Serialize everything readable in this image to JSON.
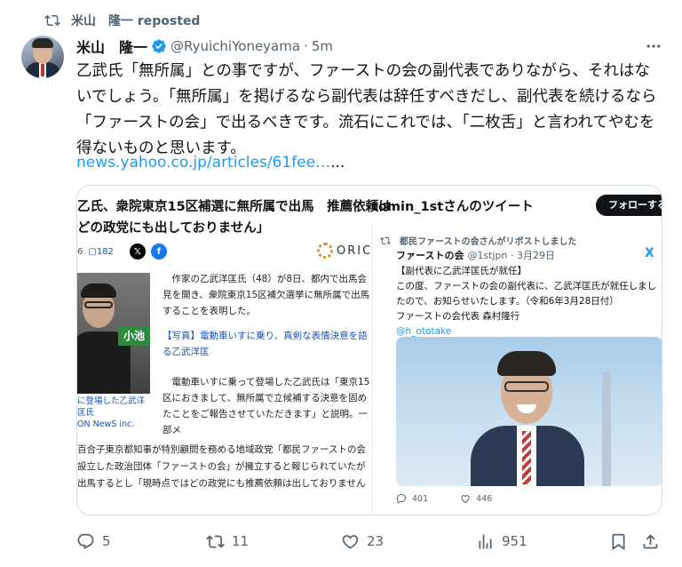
{
  "repost": {
    "label": "米山　隆一 reposted"
  },
  "author": {
    "name": "米山　隆一",
    "handle": "@RyuichiYoneyama",
    "separator": "·",
    "time": "5m"
  },
  "tweet": {
    "text": "乙武氏「無所属」との事ですが、ファーストの会の副代表でありながら、それはないでしょう。「無所属」を掲げるなら副代表は辞任すべきだし、副代表を続けるなら「ファーストの会」で出るべきです。流石にこれでは、「二枚舌」と言われてやむを得ないものと思います。",
    "link": "news.yahoo.co.jp/articles/61fee…",
    "link_suffix": "..."
  },
  "card": {
    "article": {
      "headline_line1": "乙氏、衆院東京15区補選に無所属で出馬　推薦依頼は",
      "headline_line2": "どの政党にも出しておりません」",
      "meta_count": "6",
      "comments": "182",
      "source": "ORICO",
      "photo_sign": "小池",
      "photo_caption": "に登場した乙武洋匡氏\nON NewS inc.",
      "body_p1": "作家の乙武洋匡氏（48）が8日、都内で出馬会見を開き、衆院東京15区補欠選挙に無所属で出馬することを表明した。",
      "body_link": "【写真】電動車いすに乗り、真剣な表情決意を語る乙武洋匡",
      "body_p2": "電動車いすに乗って登場した乙武氏は「東京15区におきまして、無所属で立候補する決意を固めたことをご報告させていただきます」と説明。一部メ",
      "bottom_lines": [
        "百合子東京都知事が特別顧問を務める地域政党「都民ファーストの会",
        "設立した政治団体「ファーストの会」が擁立すると報じられていたが",
        "出馬するとし「現時点ではどの政党にも推薦依頼は出しておりません"
      ]
    },
    "embed": {
      "title": "tomin_1stさんのツイート",
      "follow_label": "フォローする",
      "reposted_by": "都民ファーストの会さんがリポストしました",
      "account_name": "ファーストの会",
      "account_handle": "@1stjpn · 3月29日",
      "x_logo": "X",
      "body_line1": "【副代表に乙武洋匡氏が就任】",
      "body_line2": "この度、ファーストの会の副代表に、乙武洋匡氏が就任しましたので、お知らせいたします。（令和6年3月28日付）",
      "body_line3": "ファーストの会代表 森村隆行",
      "body_mention": "@h_ototake",
      "likes": "401",
      "hearts": "446"
    }
  },
  "actions": {
    "replies": "5",
    "reposts": "11",
    "likes": "23",
    "views": "951"
  },
  "colors": {
    "accent": "#1d9bf0",
    "muted": "#536471",
    "text": "#0f1419",
    "border": "#cfd9de"
  }
}
